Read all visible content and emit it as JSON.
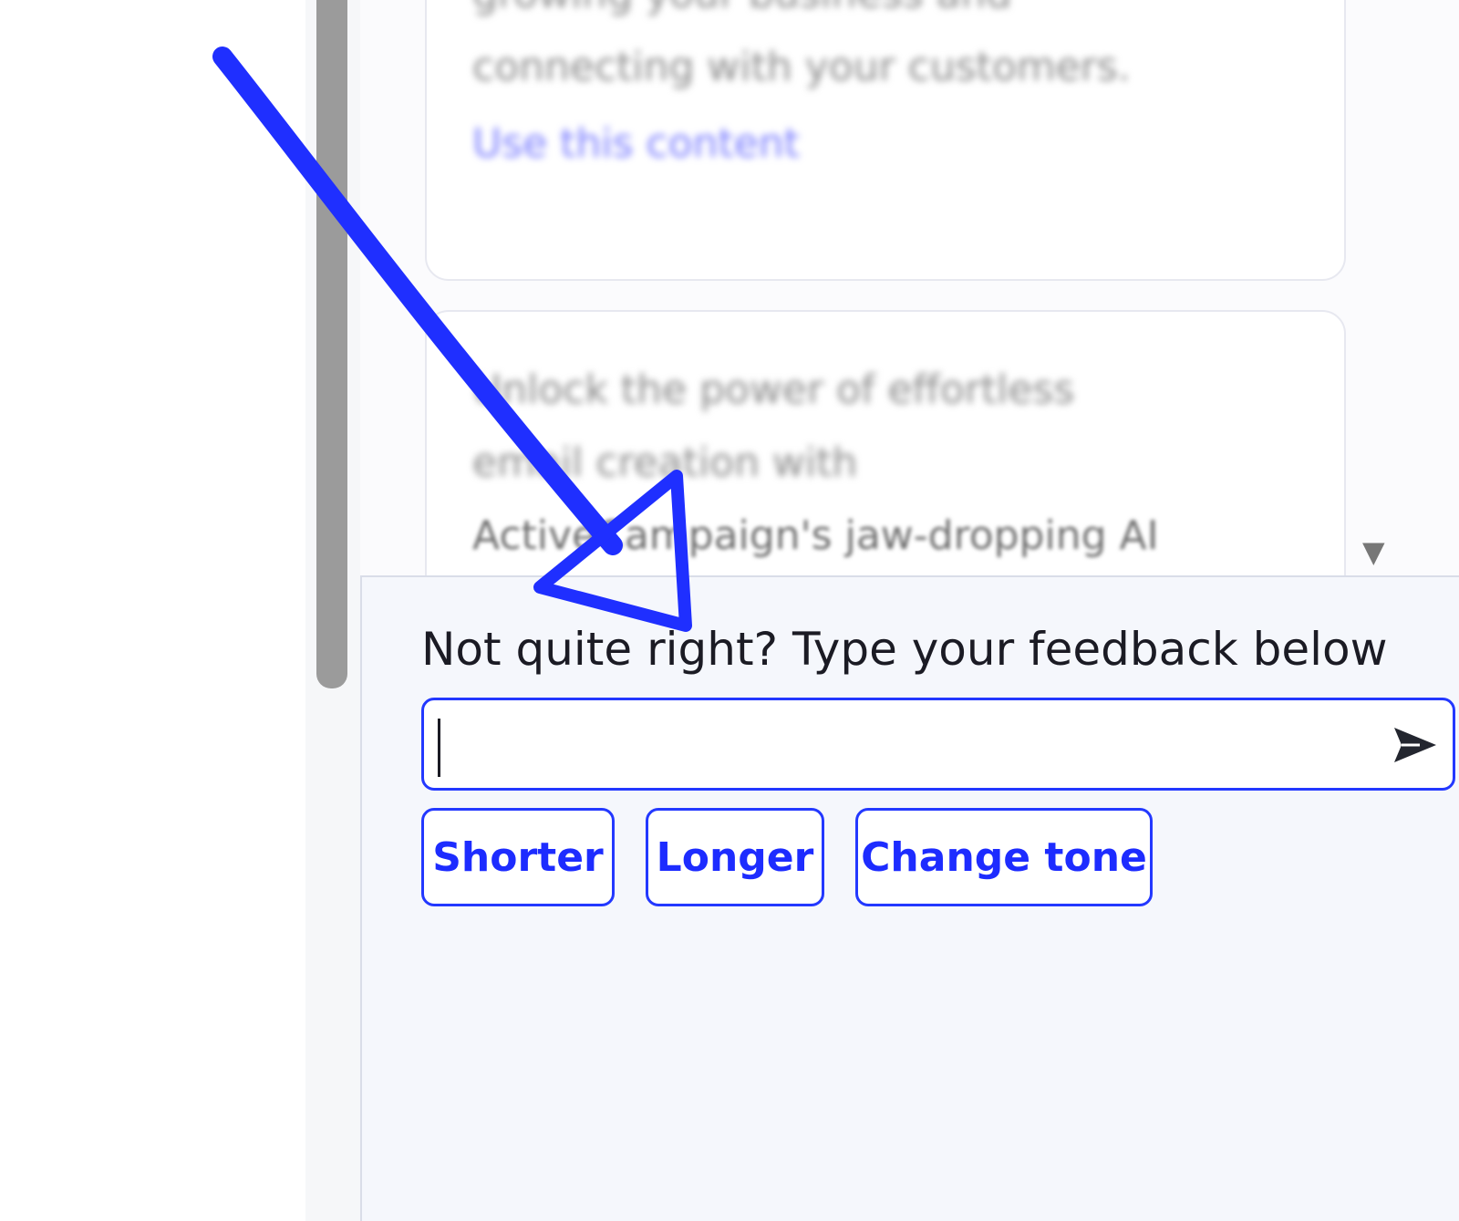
{
  "background_cards": {
    "card1": {
      "lines": [
        "growing your business and",
        "connecting with your customers."
      ],
      "link_label": "Use this content"
    },
    "card2": {
      "lines": [
        "Unlock the power of effortless",
        "email creation with"
      ],
      "visible_line": "ActiveCampaign's jaw-dropping AI"
    }
  },
  "feedback": {
    "title": "Not quite right? Type your feedback below",
    "input_value": "",
    "input_placeholder": "",
    "send_icon": "send-arrow-icon",
    "chips": [
      "Shorter",
      "Longer",
      "Change tone"
    ]
  },
  "colors": {
    "accent": "#2338ff",
    "annotation_arrow": "#1f2fff",
    "panel_background": "#f5f7fc",
    "scrollbar": "#9b9b9b"
  }
}
